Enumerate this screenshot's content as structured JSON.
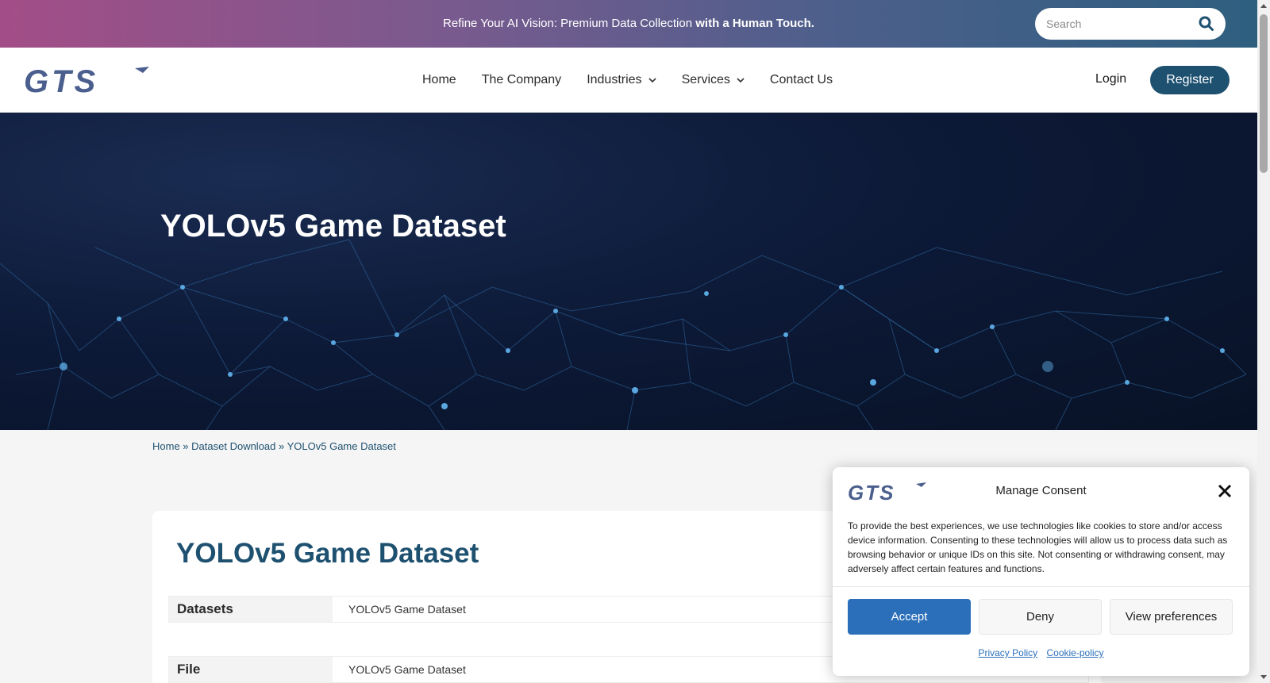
{
  "topbar": {
    "message_plain": "Refine Your AI Vision: Premium Data Collection ",
    "message_bold": "with a Human Touch.",
    "search_placeholder": "Search"
  },
  "header": {
    "logo_text": "GTS",
    "nav": [
      {
        "label": "Home"
      },
      {
        "label": "The Company"
      },
      {
        "label": "Industries"
      },
      {
        "label": "Services"
      },
      {
        "label": "Contact Us"
      }
    ],
    "login_label": "Login",
    "register_label": "Register"
  },
  "hero": {
    "title": "YOLOv5 Game Dataset"
  },
  "breadcrumb": {
    "home": "Home",
    "sep": " » ",
    "section": "Dataset Download",
    "current": "YOLOv5 Game Dataset"
  },
  "card": {
    "title": "YOLOv5 Game Dataset",
    "rows": [
      {
        "key": "Datasets",
        "value": "YOLOv5 Game Dataset"
      },
      {
        "key": "File",
        "value": "YOLOv5 Game Dataset"
      }
    ]
  },
  "consent": {
    "title": "Manage Consent",
    "body": "To provide the best experiences, we use technologies like cookies to store and/or access device information. Consenting to these technologies will allow us to process data such as browsing behavior or unique IDs on this site. Not consenting or withdrawing consent, may adversely affect certain features and functions.",
    "accept_label": "Accept",
    "deny_label": "Deny",
    "preferences_label": "View preferences",
    "privacy_link": "Privacy Policy",
    "cookie_link": "Cookie-policy"
  },
  "colors": {
    "brand": "#1e5170",
    "accept": "#2b6fba",
    "logo": "#4b5f8e"
  }
}
